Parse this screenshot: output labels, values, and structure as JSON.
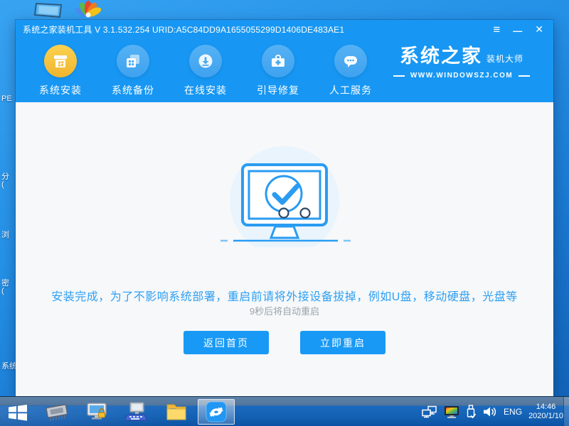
{
  "window": {
    "title": "系统之家装机工具 V 3.1.532.254 URID:A5C84DD9A1655055299D1406DE483AE1",
    "controls": {
      "menu": "≡",
      "minimize": "—",
      "close": "✕"
    }
  },
  "nav": {
    "items": [
      {
        "label": "系统安装",
        "active": true
      },
      {
        "label": "系统备份",
        "active": false
      },
      {
        "label": "在线安装",
        "active": false
      },
      {
        "label": "引导修复",
        "active": false
      },
      {
        "label": "人工服务",
        "active": false
      }
    ],
    "logo": {
      "title": "系统之家",
      "subtitle": "装机大师",
      "website": "WWW.WINDOWSZJ.COM"
    }
  },
  "main": {
    "message": "安装完成，为了不影响系统部署，重启前请将外接设备拔掉，例如U盘，移动硬盘，光盘等",
    "countdown": "9秒后将自动重启",
    "back_button": "返回首页",
    "restart_button": "立即重启"
  },
  "desktop": {
    "fragments": [
      "PE",
      "分",
      "(",
      "浏",
      "密",
      "(",
      "系统"
    ]
  },
  "taskbar": {
    "language": "ENG",
    "time": "14:46",
    "date": "2020/1/10"
  },
  "colors": {
    "accent_blue": "#1797f3",
    "button_blue": "#1899f5",
    "active_icon_yellow": "#f2bd37",
    "message_blue": "#2e9ff2",
    "taskbar_blue": "#1563b6"
  }
}
